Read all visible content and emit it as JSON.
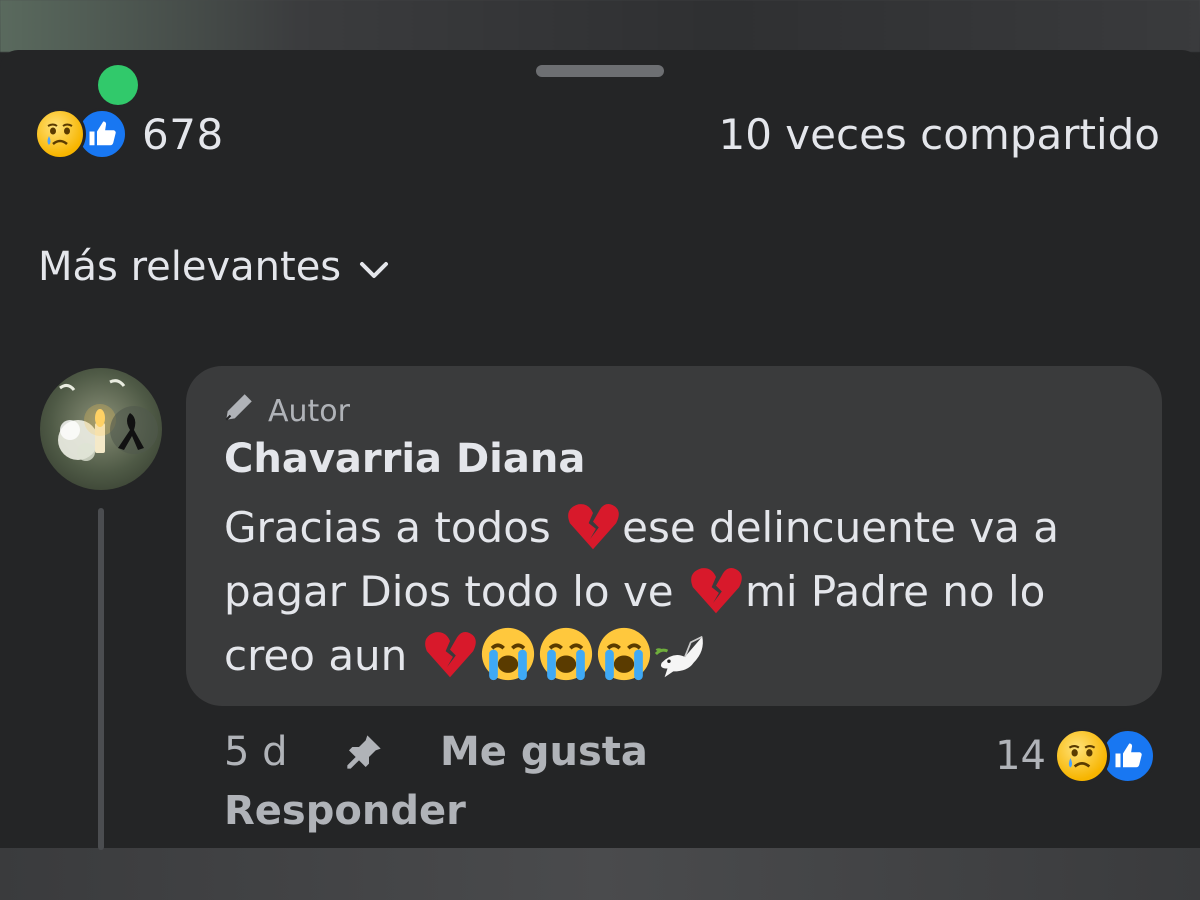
{
  "post": {
    "reactions": {
      "count": "678",
      "icons": [
        "sad-reaction-icon",
        "like-reaction-icon"
      ]
    },
    "shares_label": "10 veces compartido"
  },
  "sort": {
    "label": "Más relevantes",
    "icon": "chevron-down-icon"
  },
  "comment": {
    "badge": "Autor",
    "badge_icon": "pencil-icon",
    "author": "Chavarria Diana",
    "text": {
      "part1": "Gracias a todos ",
      "part2": "ese delincuente va a pagar Dios todo lo ve ",
      "part3": "mi Padre no lo creo aun "
    },
    "emojis": [
      "broken-heart",
      "broken-heart",
      "broken-heart",
      "loudly-crying-face",
      "loudly-crying-face",
      "loudly-crying-face",
      "dove"
    ],
    "time": "5 d",
    "like_label": "Me gusta",
    "reply_label": "Responder",
    "reaction_count": "14"
  },
  "colors": {
    "background": "#242526",
    "bubble": "#3a3b3c",
    "text": "#e4e6eb",
    "secondary_text": "#b0b3b8",
    "like_blue": "#1877f2",
    "online_green": "#31c96b"
  }
}
